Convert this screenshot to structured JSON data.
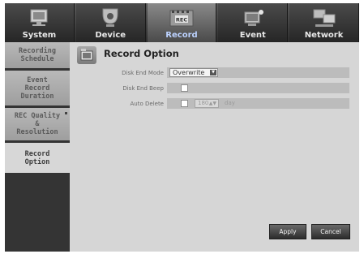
{
  "tabs": [
    {
      "label": "System",
      "icon": "system-icon",
      "active": false
    },
    {
      "label": "Device",
      "icon": "camera-icon",
      "active": false
    },
    {
      "label": "Record",
      "icon": "rec-icon",
      "active": true,
      "icon_text": "REC"
    },
    {
      "label": "Event",
      "icon": "event-icon",
      "active": false
    },
    {
      "label": "Network",
      "icon": "network-icon",
      "active": false
    }
  ],
  "sidebar": {
    "items": [
      {
        "label": "Recording\nSchedule",
        "active": false
      },
      {
        "label": "Event\nRecord\nDuration",
        "active": false
      },
      {
        "label": "REC Quality\n&\nResolution",
        "active": false
      },
      {
        "label": "Record\nOption",
        "active": true
      }
    ]
  },
  "panel": {
    "title": "Record Option",
    "disk_end_mode": {
      "label": "Disk End Mode",
      "value": "Overwrite"
    },
    "disk_end_beep": {
      "label": "Disk End Beep",
      "checked": false
    },
    "auto_delete": {
      "label": "Auto Delete",
      "checked": false,
      "value": "180",
      "unit": "day"
    }
  },
  "buttons": {
    "apply": "Apply",
    "cancel": "Cancel"
  },
  "colors": {
    "tab_label_active": "#bcd2ff",
    "panel_bg": "#d6d6d6",
    "sidebar_bg": "#343434"
  }
}
